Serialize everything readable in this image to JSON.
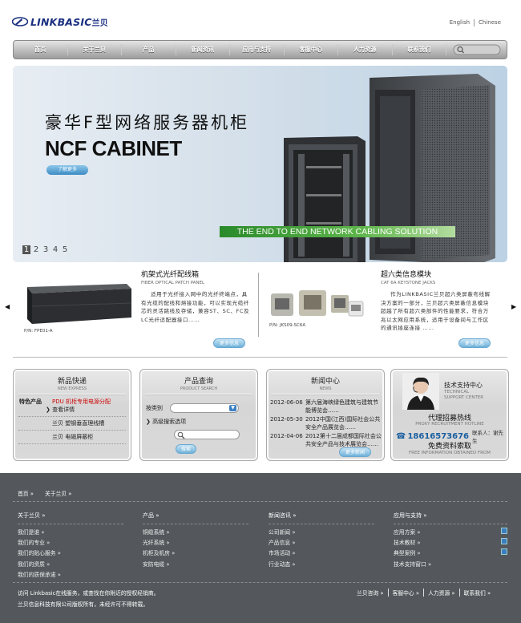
{
  "brand": {
    "logo_text": "LINKBASIC",
    "logo_cn": "兰贝"
  },
  "langs": [
    "English",
    "Chinese"
  ],
  "nav": [
    "首页",
    "关于兰贝",
    "产品",
    "新闻资讯",
    "应用与支持",
    "客服中心",
    "人力资源",
    "联系我们"
  ],
  "banner": {
    "title": "豪华F型网络服务器机柜",
    "subtitle": "NCF CABINET",
    "button": "了解更多",
    "strip": "THE END TO END NETWORK CABLING SOLUTION",
    "pages": [
      "1",
      "2",
      "3",
      "4",
      "5"
    ]
  },
  "products": [
    {
      "title": "机架式光纤配线箱",
      "en": "FIBER OPTICAL PATCH PANEL",
      "desc": "适用于光纤接入网中的光纤终端点，具有光缆的配线和熔接功能，可以实现光缆纤芯的灵活跳线及存储，兼容ST、SC、FC及LC光纤适配器接口……",
      "pn": "P/N: FPE01-A",
      "more": "更多信息"
    },
    {
      "title": "超六类信息模块",
      "en": "CAT 6A KEYSTONE JACKS",
      "desc": "作为LINKBASIC兰贝超六类屏蔽布线解决方案的一部分，兰贝超六类屏蔽信息模块超越了所有超六类部件的性能要求，符合万兆以太网应用系统，适用于设备间与工作区的通讯插座连接 ……",
      "pn": "P/N: JKS09-SC6A",
      "more": "更多信息"
    }
  ],
  "express": {
    "title": "新品快递",
    "en": "NEW EXPRESS",
    "feature_label": "特色产品",
    "feature_value": "PDU 机柜专用电源分配",
    "view": "查看详情",
    "items": [
      "兰贝 塑钢垂直理线槽",
      "兰贝 电磁屏蔽柜"
    ]
  },
  "search": {
    "title": "产品查询",
    "en": "PRODUCT SEARCH",
    "category": "按类别",
    "advanced": "高级搜索选项",
    "button": "搜索"
  },
  "news": {
    "title": "新闻中心",
    "en": "NEWS",
    "items": [
      {
        "date": "2012-06-06",
        "text": "第六届海峡绿色建筑与建筑节能博览会……"
      },
      {
        "date": "2012-05-30",
        "text": "2012中国(江西)国际社会公共安全产品展览会……"
      },
      {
        "date": "2012-04-06",
        "text": "2012第十二届成都国际社会公共安全产品与技术展览会……"
      }
    ],
    "more": "更多新闻"
  },
  "support": {
    "title": "技术支持中心",
    "en1": "TECHNICAL",
    "en2": "SUPPORT CENTER",
    "hotline": "代理招募热线",
    "hotline_en": "PROXY RECRUITMENT HOTLINE",
    "phone": "18616573676",
    "contact": "联系人：谢先生",
    "free": "免费资料索取",
    "free_en": "FREE INFORMATION OBTAINED FROM"
  },
  "footer": {
    "breadcrumb": [
      "首页",
      "关于兰贝"
    ],
    "cols": [
      {
        "head": "关于兰贝",
        "items": [
          "我们是谁",
          "我们的专业",
          "我们的贴心服务",
          "我们的资质",
          "我们的质保承诺"
        ]
      },
      {
        "head": "产品",
        "items": [
          "铜缆系统",
          "光纤系统",
          "机柜及机房",
          "安防电缆"
        ]
      },
      {
        "head": "新闻咨讯",
        "items": [
          "公司新闻",
          "产品信息",
          "市场活动",
          "行业动态"
        ]
      },
      {
        "head": "应用与支持",
        "items": [
          "应用方案",
          "技术教材",
          "典型案例",
          "技术支持窗口"
        ]
      }
    ],
    "notice": "访问 Linkbasic在线服务，或查找在你附近的授权经销商。",
    "copyright": "兰贝信息科技有限公司版权所有，未经许可不得转载。",
    "links": [
      "兰贝咨询",
      "客服中心",
      "人力资源",
      "联系我们"
    ]
  },
  "colors": {
    "brand": "#1a2f80",
    "accent": "#3a8bc4",
    "footer": "#54585c",
    "banner_strip": "#5db54a"
  }
}
